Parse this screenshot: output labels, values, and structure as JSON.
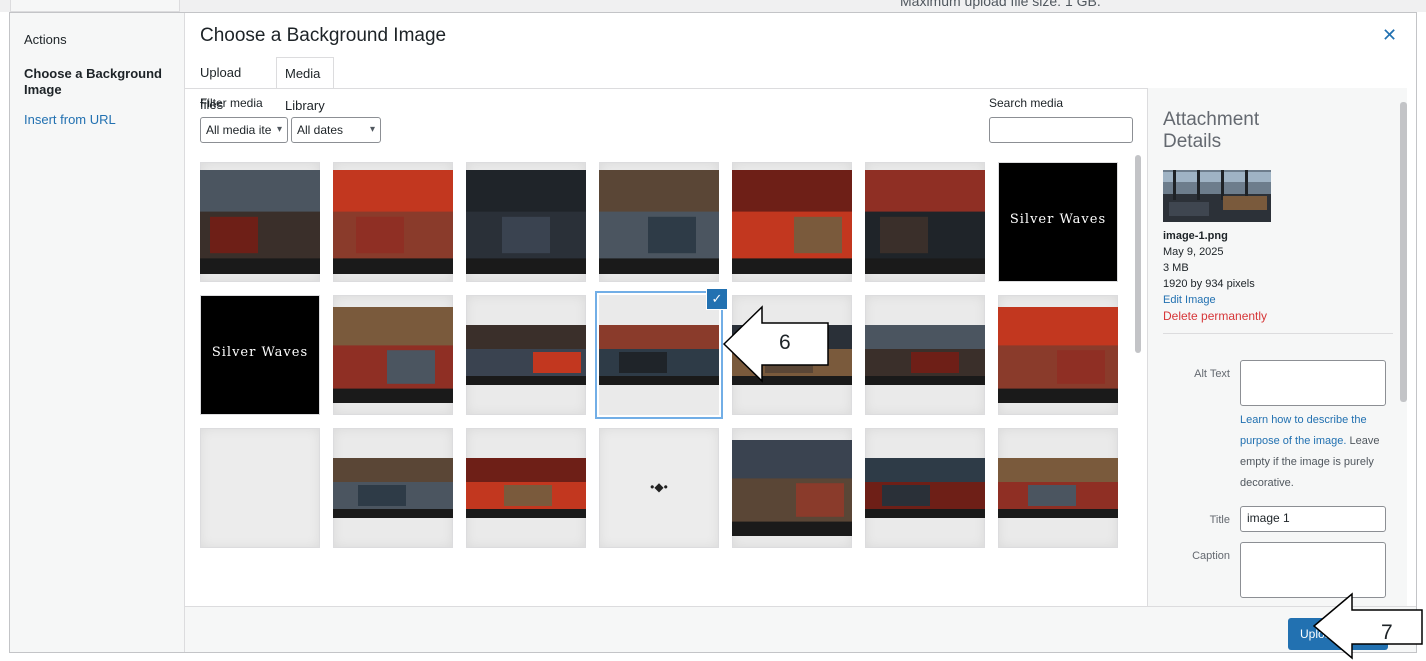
{
  "background": {
    "partial_text": "Maximum upload file size: 1 GB."
  },
  "menu": {
    "heading": "Actions",
    "active_item": "Choose a Background Image",
    "items": [
      {
        "label": "Insert from URL"
      }
    ]
  },
  "modal": {
    "title": "Choose a Background Image",
    "close_icon": "close-icon"
  },
  "tabs": [
    {
      "label": "Upload files",
      "active": false
    },
    {
      "label": "Media Library",
      "active": true
    }
  ],
  "filters": {
    "label": "Filter media",
    "type_select": {
      "value": "All media ite"
    },
    "date_select": {
      "value": "All dates"
    },
    "search_label": "Search media",
    "search_value": ""
  },
  "media": [
    {
      "kind": "photo-restaurant",
      "selected": false
    },
    {
      "kind": "photo-restaurant",
      "selected": false
    },
    {
      "kind": "photo-restaurant",
      "selected": false
    },
    {
      "kind": "photo-restaurant",
      "selected": false
    },
    {
      "kind": "photo-restaurant",
      "selected": false
    },
    {
      "kind": "photo-restaurant",
      "selected": false
    },
    {
      "kind": "logo-silver-waves",
      "selected": false,
      "logo_text": "Silver Waves"
    },
    {
      "kind": "logo-silver-waves",
      "selected": false,
      "logo_text": "Silver Waves"
    },
    {
      "kind": "photo-dish",
      "selected": false
    },
    {
      "kind": "photo-restaurant",
      "selected": false
    },
    {
      "kind": "photo-restaurant",
      "selected": true
    },
    {
      "kind": "photo-restaurant",
      "selected": false
    },
    {
      "kind": "photo-restaurant",
      "selected": false
    },
    {
      "kind": "photo-dish",
      "selected": false
    },
    {
      "kind": "blank",
      "selected": false
    },
    {
      "kind": "photo-restaurant",
      "selected": false
    },
    {
      "kind": "photo-restaurant",
      "selected": false
    },
    {
      "kind": "logo-small",
      "selected": false
    },
    {
      "kind": "photo-dish",
      "selected": false
    },
    {
      "kind": "photo-restaurant",
      "selected": false
    },
    {
      "kind": "photo-restaurant",
      "selected": false
    }
  ],
  "details": {
    "heading": "Attachment Details",
    "filename": "image-1.png",
    "date": "May 9, 2025",
    "size": "3 MB",
    "dimensions": "1920 by 934 pixels",
    "edit_link": "Edit Image",
    "delete_link": "Delete permanently",
    "alt_label": "Alt Text",
    "alt_value": "",
    "help_link": "Learn how to describe the purpose of the image.",
    "help_text": "Leave empty if the image is purely decorative.",
    "title_label": "Title",
    "title_value": "image 1",
    "caption_label": "Caption",
    "caption_value": ""
  },
  "toolbar": {
    "primary_label": "Upload"
  },
  "callouts": [
    {
      "number": "6"
    },
    {
      "number": "7"
    }
  ],
  "colors": {
    "accent": "#2271b1",
    "danger": "#d63638",
    "selected_outline": "#72aee6"
  }
}
